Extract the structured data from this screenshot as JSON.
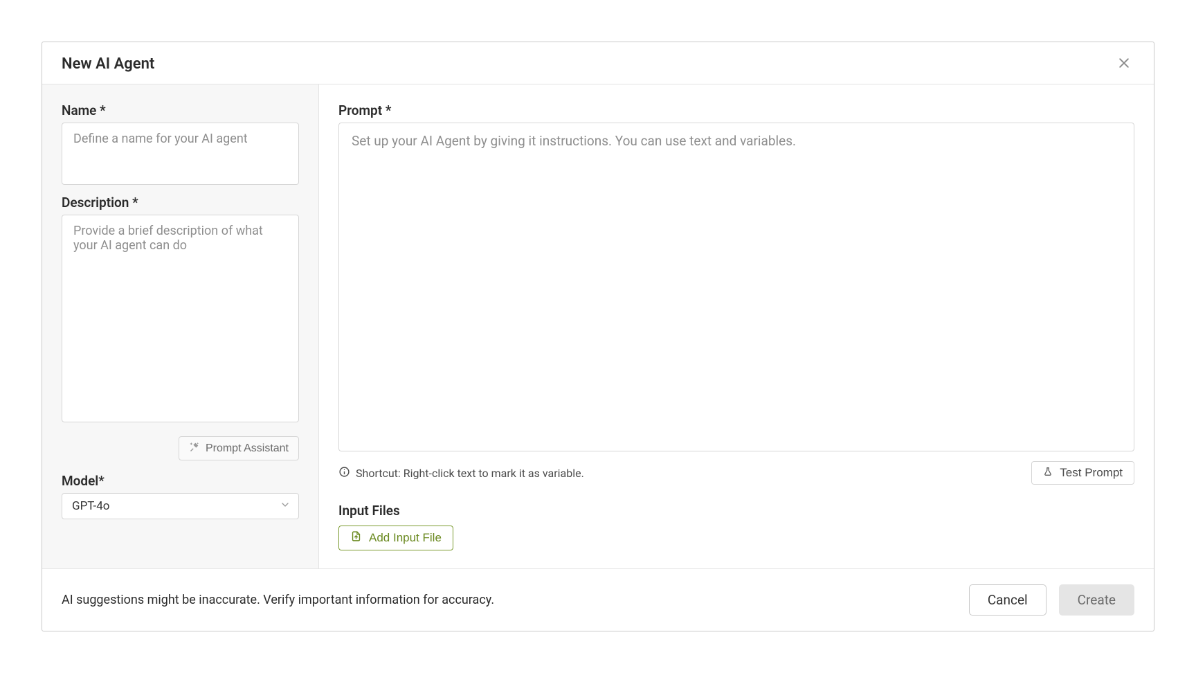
{
  "modal": {
    "title": "New AI Agent"
  },
  "left": {
    "name_label": "Name *",
    "name_placeholder": "Define a name for your AI agent",
    "desc_label": "Description *",
    "desc_placeholder": "Provide a brief description of what your AI agent can do",
    "prompt_assistant": "Prompt Assistant",
    "model_label": "Model*",
    "model_value": "GPT-4o"
  },
  "right": {
    "prompt_label": "Prompt *",
    "prompt_placeholder": "Set up your AI Agent by giving it instructions. You can use text and variables.",
    "shortcut_text": "Shortcut: Right-click text to mark it as variable.",
    "test_prompt": "Test Prompt",
    "input_files_label": "Input Files",
    "add_input_file": "Add Input File"
  },
  "footer": {
    "note": "AI suggestions might be inaccurate. Verify important information for accuracy.",
    "cancel": "Cancel",
    "create": "Create"
  }
}
